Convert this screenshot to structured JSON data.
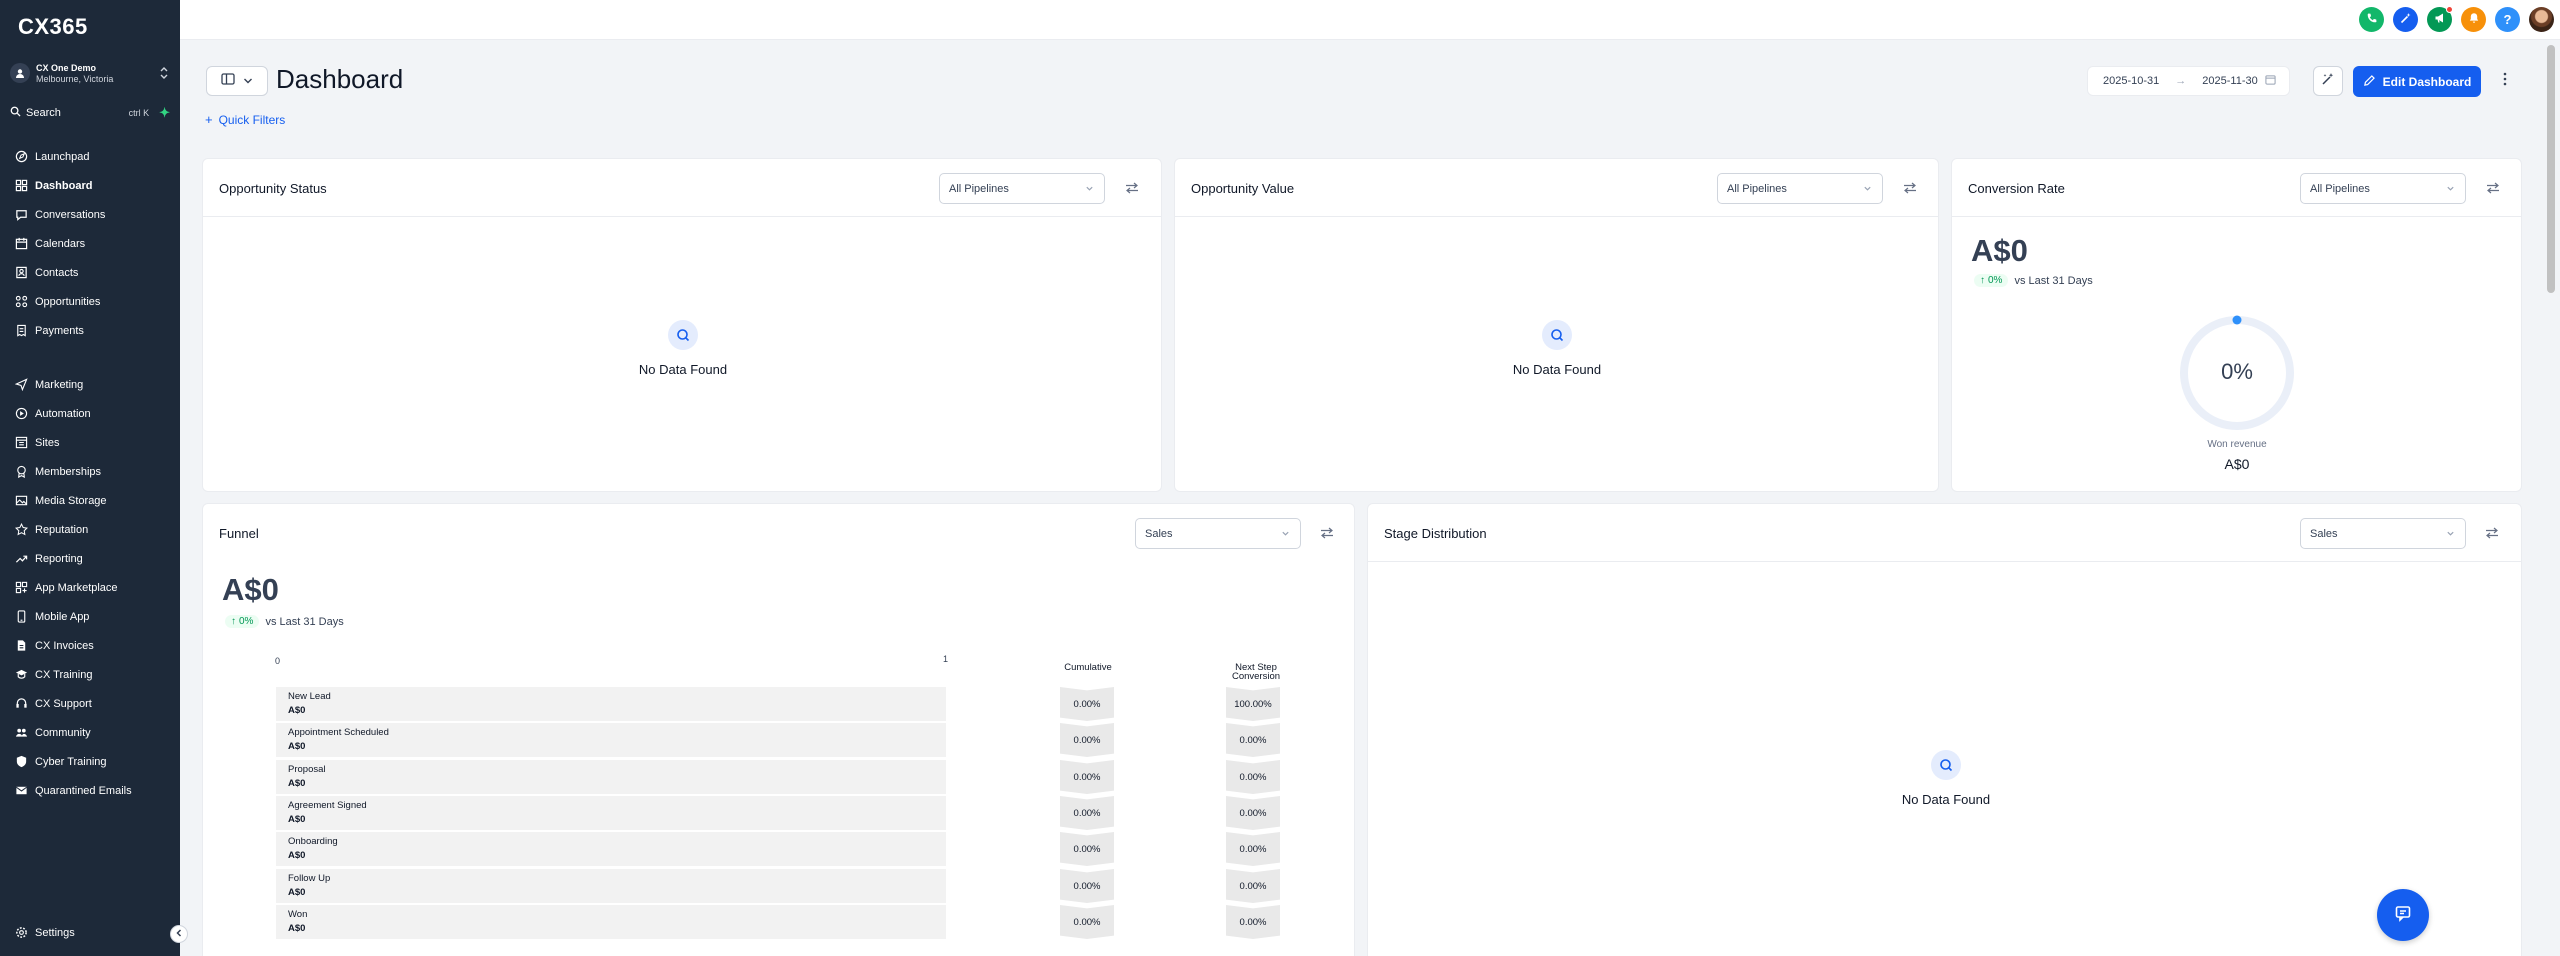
{
  "sidebar": {
    "logo": "CX365",
    "account": {
      "name": "CX One Demo",
      "location": "Melbourne, Victoria"
    },
    "search": {
      "label": "Search",
      "shortcut": "ctrl K"
    },
    "items": [
      {
        "label": "Launchpad",
        "icon": "launchpad-icon"
      },
      {
        "label": "Dashboard",
        "icon": "dashboard-icon"
      },
      {
        "label": "Conversations",
        "icon": "chat-icon"
      },
      {
        "label": "Calendars",
        "icon": "calendar-icon"
      },
      {
        "label": "Contacts",
        "icon": "contacts-icon"
      },
      {
        "label": "Opportunities",
        "icon": "opportunities-icon"
      },
      {
        "label": "Payments",
        "icon": "payments-icon"
      },
      {
        "label": "Marketing",
        "icon": "send-icon"
      },
      {
        "label": "Automation",
        "icon": "automation-icon"
      },
      {
        "label": "Sites",
        "icon": "sites-icon"
      },
      {
        "label": "Memberships",
        "icon": "memberships-icon"
      },
      {
        "label": "Media Storage",
        "icon": "media-icon"
      },
      {
        "label": "Reputation",
        "icon": "star-icon"
      },
      {
        "label": "Reporting",
        "icon": "reporting-icon"
      },
      {
        "label": "App Marketplace",
        "icon": "marketplace-icon"
      },
      {
        "label": "Mobile App",
        "icon": "mobile-icon"
      },
      {
        "label": "CX Invoices",
        "icon": "invoice-icon"
      },
      {
        "label": "CX Training",
        "icon": "training-icon"
      },
      {
        "label": "CX Support",
        "icon": "support-icon"
      },
      {
        "label": "Community",
        "icon": "community-icon"
      },
      {
        "label": "Cyber Training",
        "icon": "shield-icon"
      },
      {
        "label": "Quarantined Emails",
        "icon": "mail-icon"
      }
    ],
    "settings": {
      "label": "Settings",
      "icon": "gear-icon"
    }
  },
  "topbar": {
    "buttons": [
      {
        "name": "phone-button",
        "icon": "phone-icon",
        "color": "#12b76a"
      },
      {
        "name": "quick-actions-button",
        "icon": "magic-icon",
        "color": "#155eef"
      },
      {
        "name": "announcements-button",
        "icon": "megaphone-icon",
        "color": "#039855"
      },
      {
        "name": "notifications-button",
        "icon": "bell-icon",
        "color": "#f79009"
      },
      {
        "name": "help-button",
        "icon": "help-icon",
        "color": "#2e90fa"
      }
    ]
  },
  "header": {
    "title": "Dashboard",
    "quick_filters": "Quick Filters",
    "date_start": "2025-10-31",
    "date_end": "2025-11-30",
    "edit_button": "Edit Dashboard"
  },
  "cards": {
    "opportunity_status": {
      "title": "Opportunity Status",
      "select": "All Pipelines",
      "empty": "No Data Found"
    },
    "opportunity_value": {
      "title": "Opportunity Value",
      "select": "All Pipelines",
      "empty": "No Data Found"
    },
    "conversion_rate": {
      "title": "Conversion Rate",
      "select": "All Pipelines",
      "value": "A$0",
      "change": "0%",
      "comparison": "vs Last 31 Days",
      "gauge_percent": "0%",
      "gauge_fraction": 0,
      "won_label": "Won revenue",
      "won_value": "A$0"
    },
    "funnel": {
      "title": "Funnel",
      "select": "Sales",
      "value": "A$0",
      "change": "0%",
      "comparison": "vs Last 31 Days",
      "axis_min": "0",
      "axis_max": "1",
      "col_cumulative": "Cumulative",
      "col_next_line1": "Next Step",
      "col_next_line2": "Conversion",
      "stages": [
        {
          "name": "New Lead",
          "amount": "A$0",
          "cumulative": "0.00%",
          "next": "100.00%"
        },
        {
          "name": "Appointment Scheduled",
          "amount": "A$0",
          "cumulative": "0.00%",
          "next": "0.00%"
        },
        {
          "name": "Proposal",
          "amount": "A$0",
          "cumulative": "0.00%",
          "next": "0.00%"
        },
        {
          "name": "Agreement Signed",
          "amount": "A$0",
          "cumulative": "0.00%",
          "next": "0.00%"
        },
        {
          "name": "Onboarding",
          "amount": "A$0",
          "cumulative": "0.00%",
          "next": "0.00%"
        },
        {
          "name": "Follow Up",
          "amount": "A$0",
          "cumulative": "0.00%",
          "next": "0.00%"
        },
        {
          "name": "Won",
          "amount": "A$0",
          "cumulative": "0.00%",
          "next": "0.00%"
        }
      ]
    },
    "stage_distribution": {
      "title": "Stage Distribution",
      "select": "Sales",
      "empty": "No Data Found"
    }
  },
  "colors": {
    "sidebar": "#1d2939",
    "accent": "#155eef",
    "positive": "#039855"
  }
}
